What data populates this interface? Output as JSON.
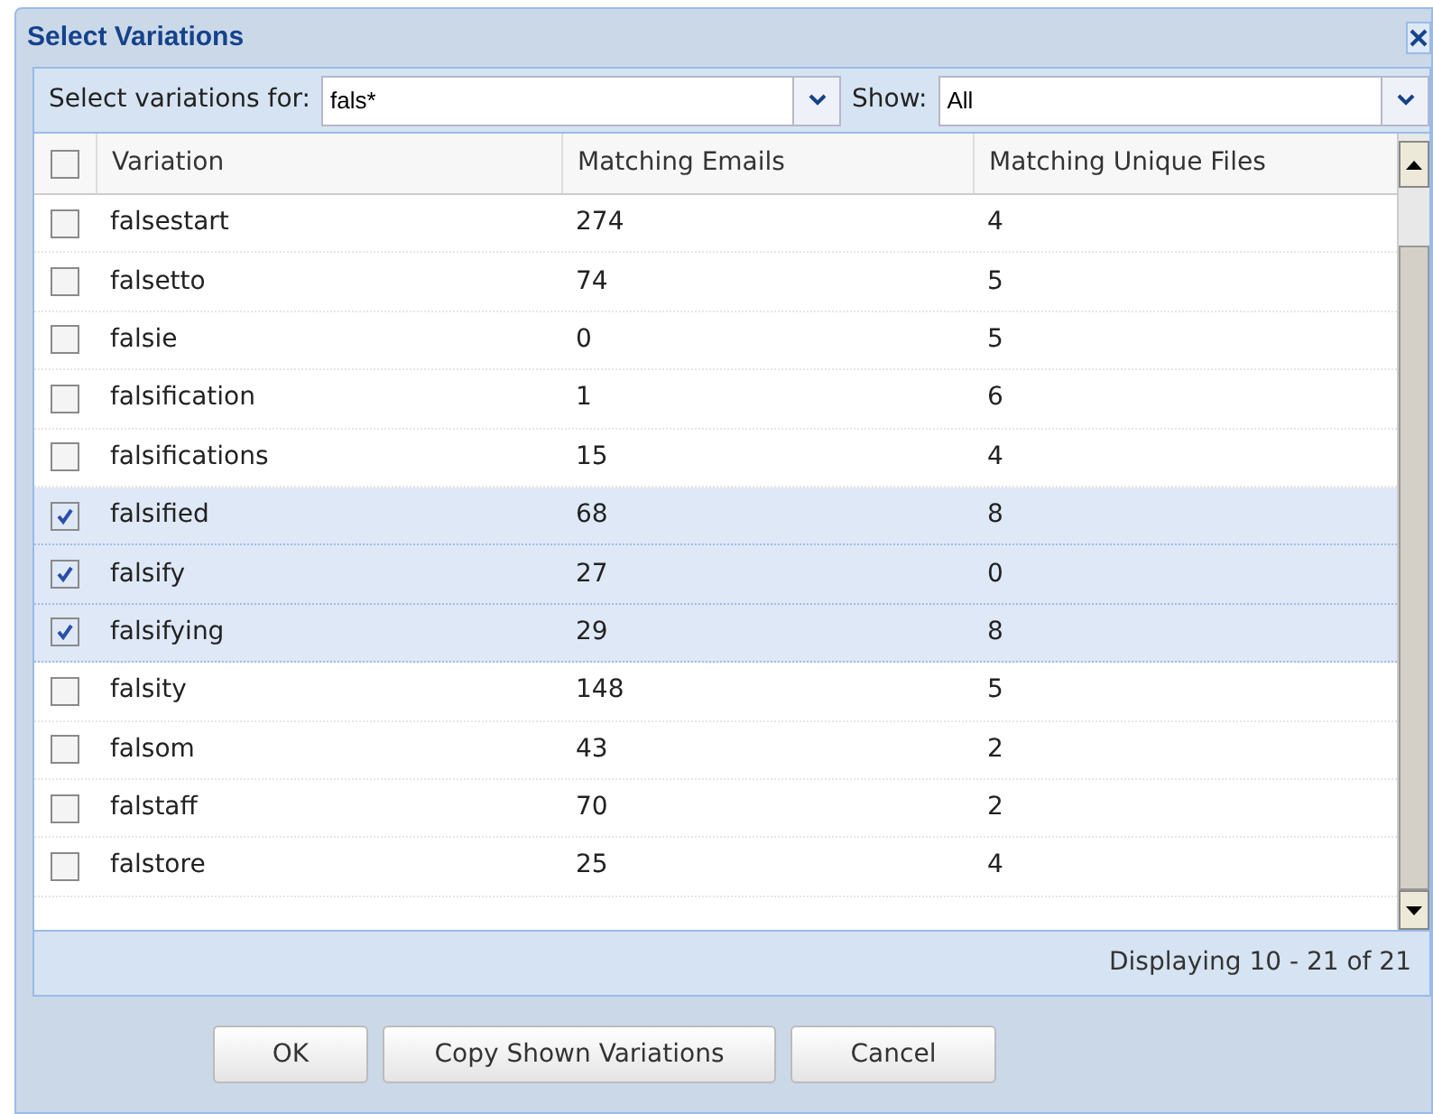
{
  "window": {
    "title": "Select Variations"
  },
  "filter": {
    "label": "Select variations for:",
    "value": "fals*",
    "show_label": "Show:",
    "show_value": "All"
  },
  "table": {
    "header_checked": false,
    "columns": [
      "Variation",
      "Matching Emails",
      "Matching Unique Files"
    ],
    "rows": [
      {
        "variation": "falsestart",
        "emails": "274",
        "files": "4",
        "checked": false
      },
      {
        "variation": "falsetto",
        "emails": "74",
        "files": "5",
        "checked": false
      },
      {
        "variation": "falsie",
        "emails": "0",
        "files": "5",
        "checked": false
      },
      {
        "variation": "falsification",
        "emails": "1",
        "files": "6",
        "checked": false
      },
      {
        "variation": "falsifications",
        "emails": "15",
        "files": "4",
        "checked": false
      },
      {
        "variation": "falsified",
        "emails": "68",
        "files": "8",
        "checked": true
      },
      {
        "variation": "falsify",
        "emails": "27",
        "files": "0",
        "checked": true
      },
      {
        "variation": "falsifying",
        "emails": "29",
        "files": "8",
        "checked": true
      },
      {
        "variation": "falsity",
        "emails": "148",
        "files": "5",
        "checked": false
      },
      {
        "variation": "falsom",
        "emails": "43",
        "files": "2",
        "checked": false
      },
      {
        "variation": "falstaff",
        "emails": "70",
        "files": "2",
        "checked": false
      },
      {
        "variation": "falstore",
        "emails": "25",
        "files": "4",
        "checked": false
      }
    ]
  },
  "status": "Displaying 10 - 21 of 21",
  "buttons": [
    "OK",
    "Copy Shown Variations",
    "Cancel"
  ]
}
